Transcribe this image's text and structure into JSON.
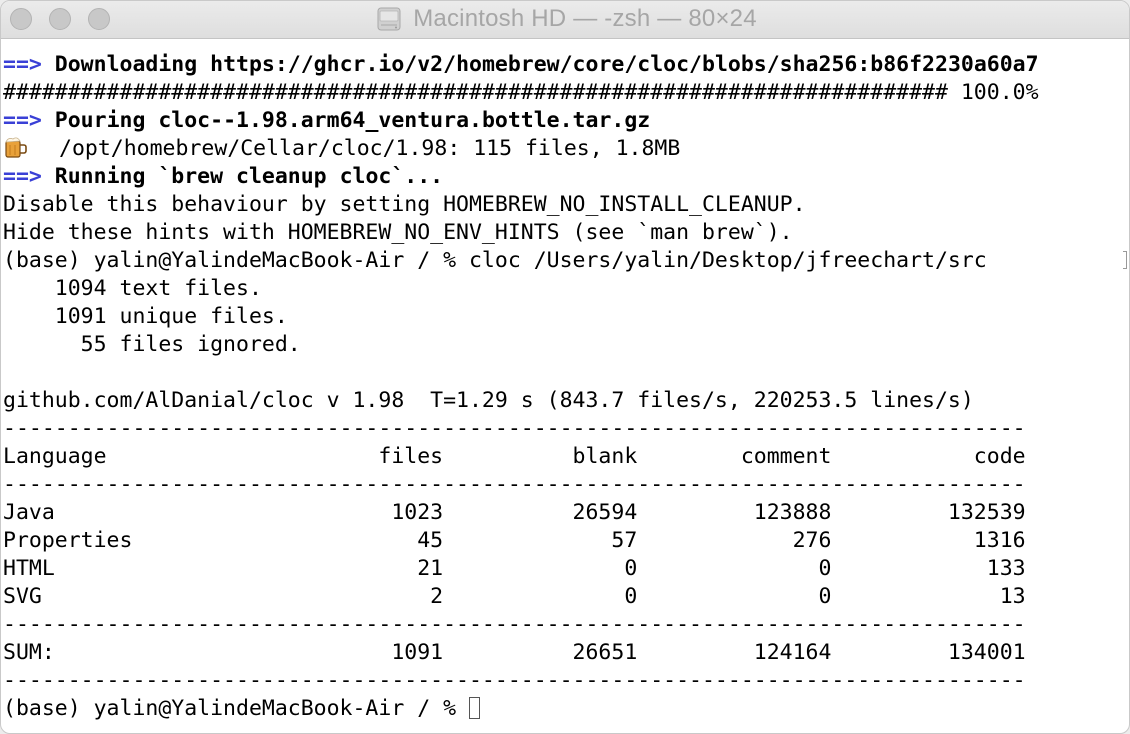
{
  "window": {
    "title": "Macintosh HD — -zsh — 80×24"
  },
  "terminal": {
    "download_arrow": "==>",
    "download_text": "Downloading https://ghcr.io/v2/homebrew/core/cloc/blobs/sha256:b86f2230a60a7",
    "progress_bar": "######################################################################### 100.0%",
    "pour_arrow": "==>",
    "pour_text": "Pouring cloc--1.98.arm64_ventura.bottle.tar.gz",
    "installed_text": "/opt/homebrew/Cellar/cloc/1.98: 115 files, 1.8MB",
    "cleanup_arrow": "==>",
    "cleanup_text": "Running `brew cleanup cloc`...",
    "hint1": "Disable this behaviour by setting HOMEBREW_NO_INSTALL_CLEANUP.",
    "hint2": "Hide these hints with HOMEBREW_NO_ENV_HINTS (see `man brew`).",
    "command": "(base) yalin@YalindeMacBook-Air / % cloc /Users/yalin/Desktop/jfreechart/src",
    "text_files": "    1094 text files.",
    "unique_files": "    1091 unique files.",
    "ignored_files": "      55 files ignored.",
    "blank_line": "",
    "summary": "github.com/AlDanial/cloc v 1.98  T=1.29 s (843.7 files/s, 220253.5 lines/s)",
    "divider": "-------------------------------------------------------------------------------",
    "table_header": "Language                     files          blank        comment           code",
    "rows": [
      "Java                          1023          26594         123888         132539",
      "Properties                      45             57            276           1316",
      "HTML                            21              0              0            133",
      "SVG                              2              0              0             13"
    ],
    "sum_row": "SUM:                          1091          26651         124164         134001",
    "prompt": "(base) yalin@YalindeMacBook-Air / % "
  }
}
